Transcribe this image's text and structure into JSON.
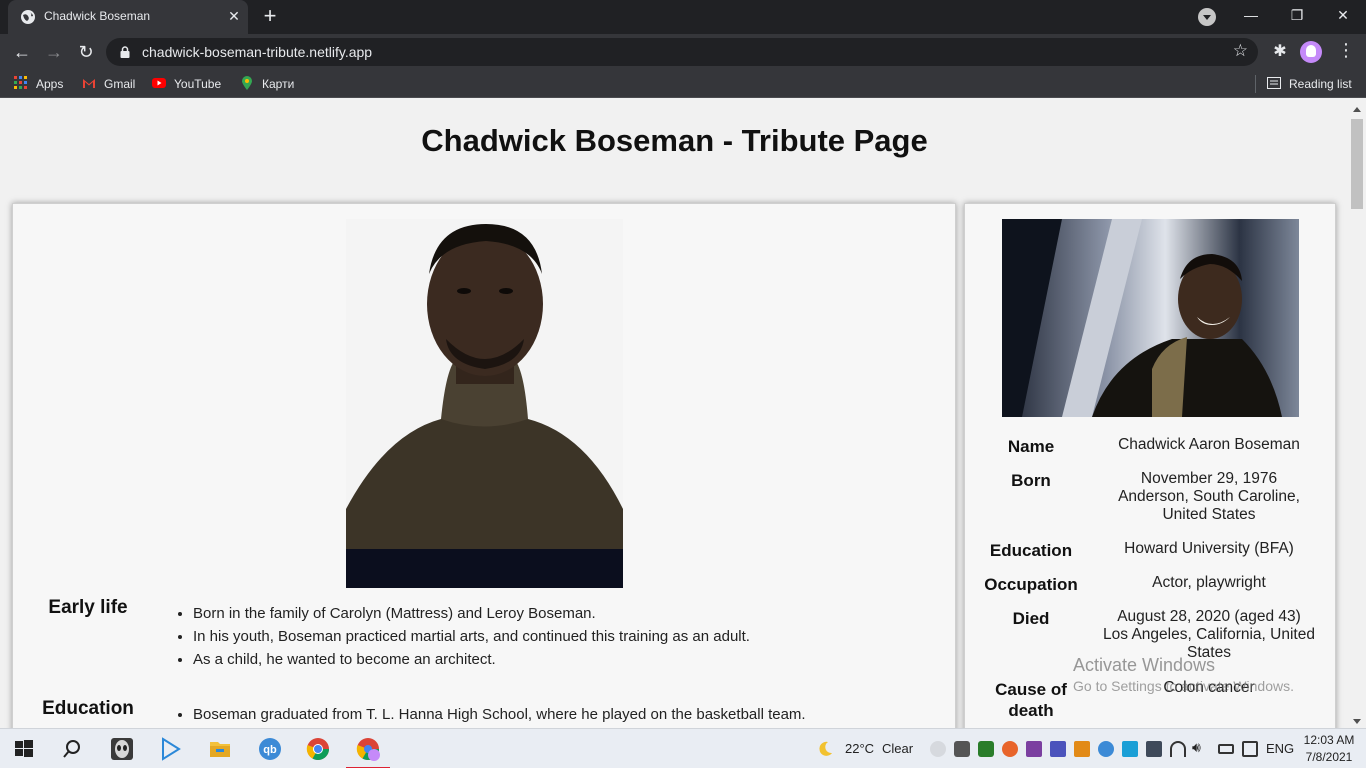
{
  "browser": {
    "tab_title": "Chadwick Boseman",
    "tab_close": "✕",
    "new_tab": "+",
    "url": "chadwick-boseman-tribute.netlify.app",
    "bookmarks": [
      "Apps",
      "Gmail",
      "YouTube",
      "Карти"
    ],
    "reading_list": "Reading list",
    "window_controls": {
      "minimize": "—",
      "restore": "❐",
      "close": "✕"
    },
    "nav": {
      "back": "←",
      "forward": "→",
      "reload": "↻"
    },
    "star": "☆",
    "extensions": "✱"
  },
  "page": {
    "title": "Chadwick Boseman - Tribute Page",
    "sections": [
      {
        "title": "Early life",
        "items": [
          "Born in the family of Carolyn (Mattress) and Leroy Boseman.",
          "In his youth, Boseman practiced martial arts, and continued this training as an adult.",
          "As a child, he wanted to become an architect."
        ]
      },
      {
        "title": "Education",
        "items": [
          "Boseman graduated from T. L. Hanna High School, where he played on the basketball team."
        ]
      }
    ],
    "info": [
      {
        "label": "Name",
        "value": "Chadwick Aaron Boseman"
      },
      {
        "label": "Born",
        "value_lines": [
          "November 29, 1976",
          "Anderson, South Caroline,",
          "United States"
        ]
      },
      {
        "label": "Education",
        "value": "Howard University (BFA)"
      },
      {
        "label": "Occupation",
        "value": "Actor, playwright"
      },
      {
        "label": "Died",
        "value_lines": [
          "August 28, 2020 (aged 43)",
          "Los Angeles, California, United",
          "States"
        ]
      },
      {
        "label_lines": [
          "Cause of",
          "death"
        ],
        "value": "Colon cancer"
      }
    ]
  },
  "watermark": {
    "title": "Activate Windows",
    "subtitle": "Go to Settings to activate Windows."
  },
  "taskbar": {
    "weather": "22°C",
    "weather_desc": "Clear",
    "language": "ENG",
    "time": "12:03 AM",
    "date": "7/8/2021"
  }
}
